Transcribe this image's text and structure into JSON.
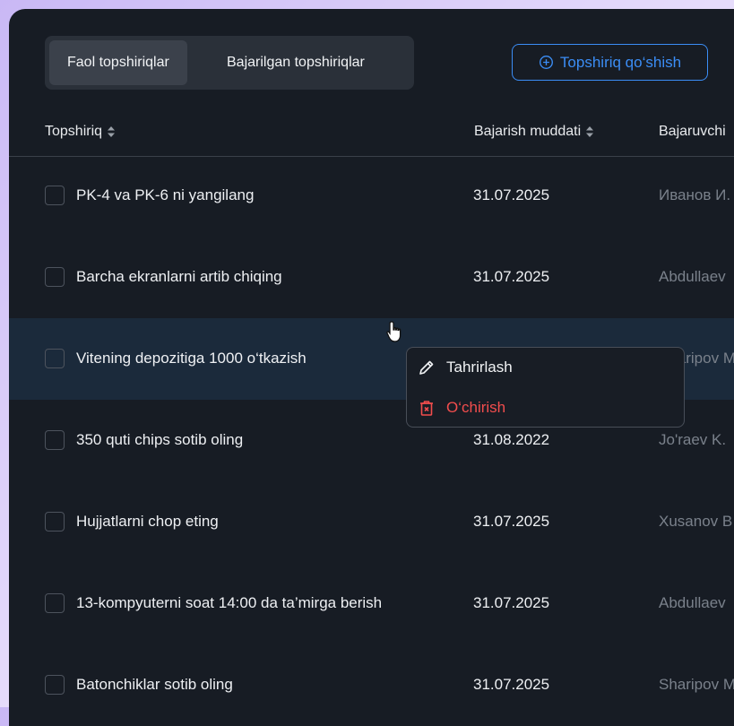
{
  "tabs": {
    "active": "Faol topshiriqlar",
    "completed": "Bajarilgan topshiriqlar"
  },
  "add_button": {
    "label": "Topshiriq qo‘shish",
    "icon": "plus-circle-icon"
  },
  "table": {
    "headers": {
      "task": "Topshiriq",
      "deadline": "Bajarish muddati",
      "assignee": "Bajaruvchi"
    },
    "rows": [
      {
        "task": "PK-4 va PK-6 ni yangilang",
        "deadline": "31.07.2025",
        "assignee": "Иванов И."
      },
      {
        "task": "Barcha ekranlarni artib chiqing",
        "deadline": "31.07.2025",
        "assignee": "Abdullaev"
      },
      {
        "task": "Vitening depozitiga 1000 o‘tkazish",
        "deadline": "",
        "assignee": "Sharipov M"
      },
      {
        "task": "350 quti chips sotib oling",
        "deadline": "31.08.2022",
        "assignee": "Jo'raev K."
      },
      {
        "task": "Hujjatlarni chop eting",
        "deadline": "31.07.2025",
        "assignee": "Xusanov B"
      },
      {
        "task": "13-kompyuterni soat 14:00 da ta’mirga berish",
        "deadline": "31.07.2025",
        "assignee": "Abdullaev"
      },
      {
        "task": "Batonchiklar sotib oling",
        "deadline": "31.07.2025",
        "assignee": "Sharipov M"
      }
    ]
  },
  "context_menu": {
    "edit": "Tahrirlash",
    "delete": "O‘chirish"
  },
  "colors": {
    "panel_bg": "#171c24",
    "accent": "#3b8df5",
    "danger": "#f24d4d",
    "row_highlight": "#1b2a3b"
  }
}
